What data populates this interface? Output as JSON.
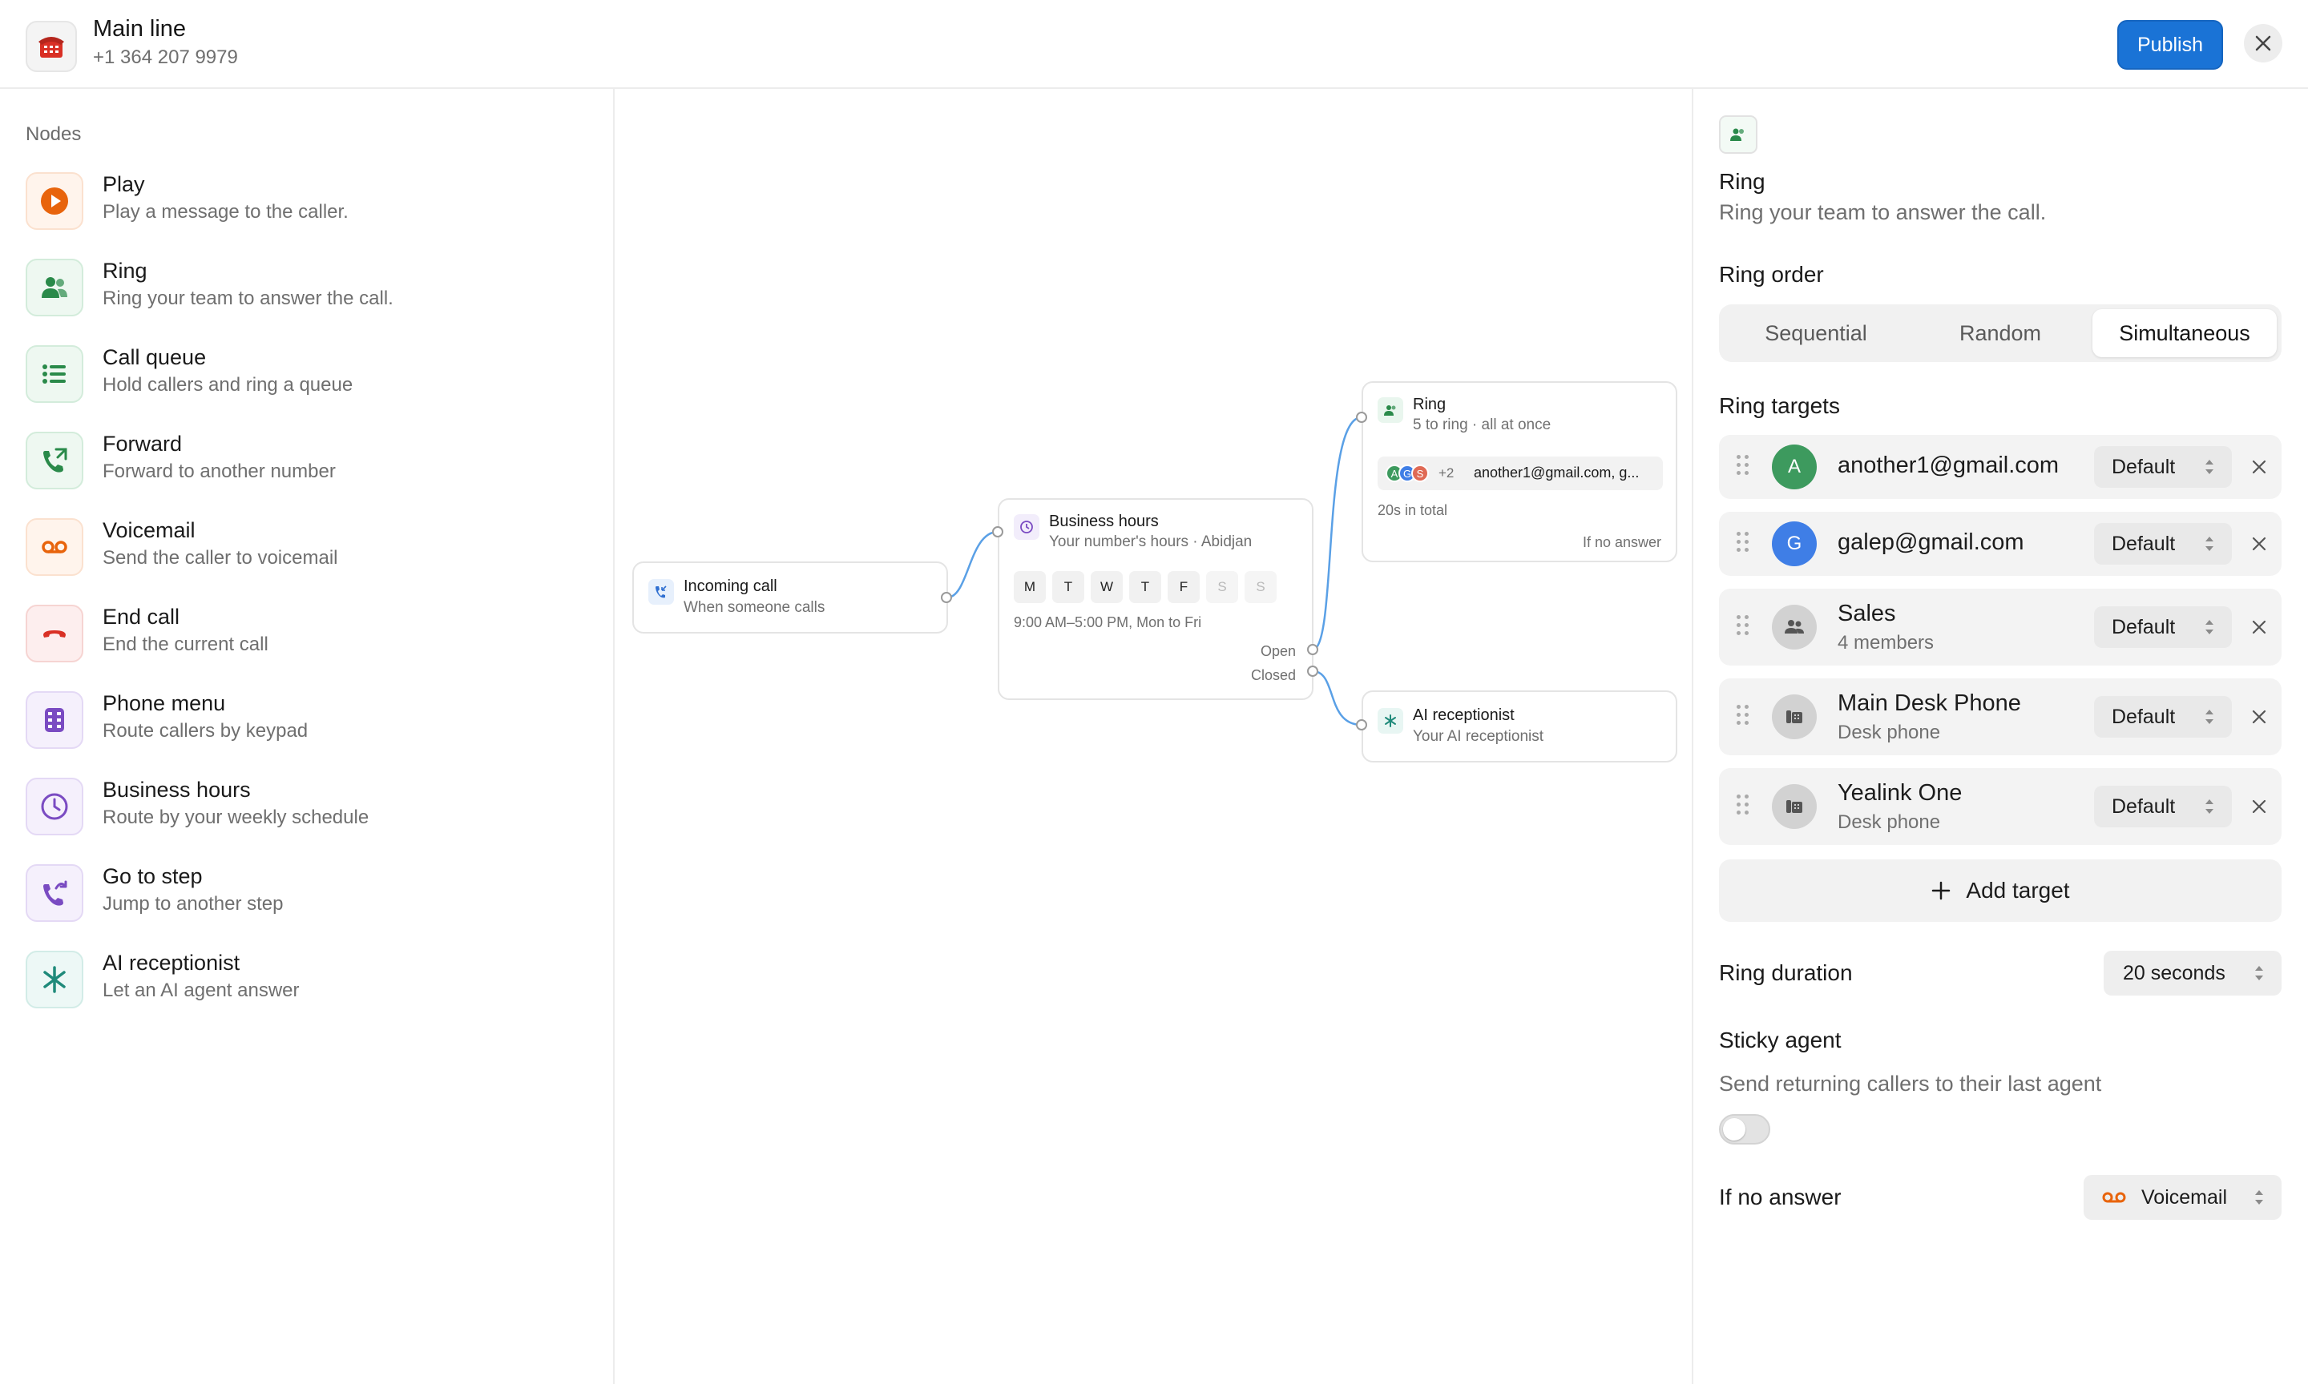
{
  "header": {
    "title": "Main line",
    "phone": "+1 364 207 9979",
    "publish_label": "Publish",
    "icon": "phone-icon"
  },
  "sidebar": {
    "section_label": "Nodes",
    "items": [
      {
        "title": "Play",
        "desc": "Play a message to the caller.",
        "icon": "play-icon",
        "color": "#e8640c"
      },
      {
        "title": "Ring",
        "desc": "Ring your team to answer the call.",
        "icon": "ring-team-icon",
        "color": "#2a8a4a"
      },
      {
        "title": "Call queue",
        "desc": "Hold callers and ring a queue",
        "icon": "queue-list-icon",
        "color": "#2a8a4a"
      },
      {
        "title": "Forward",
        "desc": "Forward to another number",
        "icon": "forward-call-icon",
        "color": "#2a8a4a"
      },
      {
        "title": "Voicemail",
        "desc": "Send the caller to voicemail",
        "icon": "voicemail-icon",
        "color": "#e8640c"
      },
      {
        "title": "End call",
        "desc": "End the current call",
        "icon": "end-call-icon",
        "color": "#d93025"
      },
      {
        "title": "Phone menu",
        "desc": "Route callers by keypad",
        "icon": "keypad-icon",
        "color": "#7a4bc2"
      },
      {
        "title": "Business hours",
        "desc": "Route by your weekly schedule",
        "icon": "clock-icon",
        "color": "#7a4bc2"
      },
      {
        "title": "Go to step",
        "desc": "Jump to another step",
        "icon": "goto-step-icon",
        "color": "#7a4bc2"
      },
      {
        "title": "AI receptionist",
        "desc": "Let an AI agent answer",
        "icon": "ai-asterisk-icon",
        "color": "#1f8a7a"
      }
    ]
  },
  "canvas": {
    "incoming": {
      "title": "Incoming call",
      "sub": "When someone calls"
    },
    "business_hours": {
      "title": "Business hours",
      "sub": "Your number's hours · Abidjan",
      "days": [
        "M",
        "T",
        "W",
        "T",
        "F",
        "S",
        "S"
      ],
      "hours": "9:00 AM–5:00 PM, Mon to Fri",
      "open_label": "Open",
      "closed_label": "Closed"
    },
    "ring": {
      "title": "Ring",
      "sub": "5 to ring · all at once",
      "avatars": [
        "A",
        "G",
        "S"
      ],
      "more": "+2",
      "targets_preview": "another1@gmail.com, g...",
      "total": "20s in total",
      "no_answer_label": "If no answer"
    },
    "ai": {
      "title": "AI receptionist",
      "sub": "Your AI receptionist"
    }
  },
  "panel": {
    "title": "Ring",
    "desc": "Ring your team to answer the call.",
    "ring_order_label": "Ring order",
    "ring_order_options": [
      "Sequential",
      "Random",
      "Simultaneous"
    ],
    "ring_order_selected": "Simultaneous",
    "ring_targets_label": "Ring targets",
    "targets": [
      {
        "name": "another1@gmail.com",
        "sub": "",
        "avatar": "A",
        "avatar_color": "#3d9a5e",
        "mode": "Default"
      },
      {
        "name": "galep@gmail.com",
        "sub": "",
        "avatar": "G",
        "avatar_color": "#3f7ee6",
        "mode": "Default"
      },
      {
        "name": "Sales",
        "sub": "4 members",
        "avatar": "group",
        "avatar_color": "#cfcfcf",
        "mode": "Default"
      },
      {
        "name": "Main Desk Phone",
        "sub": "Desk phone",
        "avatar": "desk-phone",
        "avatar_color": "#cfcfcf",
        "mode": "Default"
      },
      {
        "name": "Yealink One",
        "sub": "Desk phone",
        "avatar": "desk-phone",
        "avatar_color": "#cfcfcf",
        "mode": "Default"
      }
    ],
    "add_target_label": "Add target",
    "ring_duration_label": "Ring duration",
    "ring_duration_value": "20 seconds",
    "sticky_label": "Sticky agent",
    "sticky_desc": "Send returning callers to their last agent",
    "sticky_enabled": false,
    "no_answer_label": "If no answer",
    "no_answer_value": "Voicemail"
  }
}
